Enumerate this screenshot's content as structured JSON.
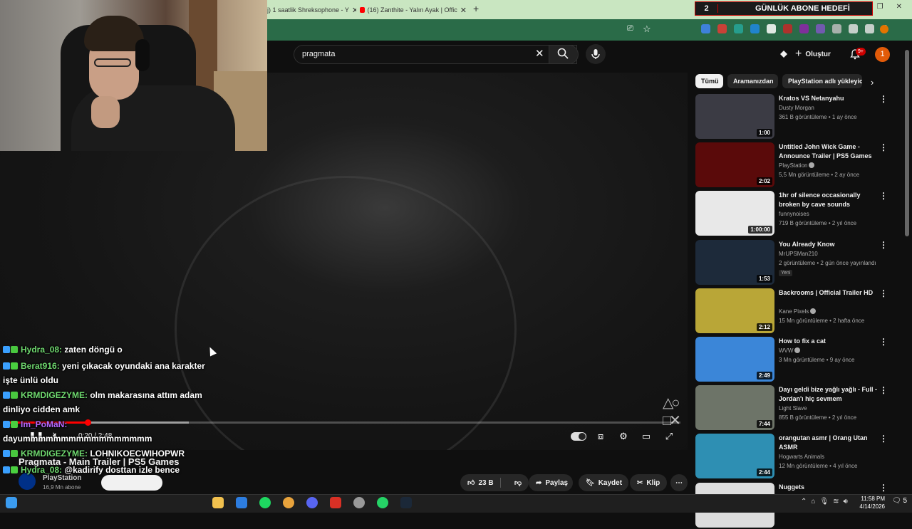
{
  "browser": {
    "tabs": [
      {
        "label": "j) 1 saatlik Shreksophone - Y"
      },
      {
        "label": "(16) Zanthite - Yalın Ayak | Offic"
      }
    ],
    "new_tab": "+",
    "close": "✕"
  },
  "stream_goal": {
    "count": "2",
    "label": "GÜNLÜK ABONE HEDEFİ"
  },
  "search": {
    "query": "pragmata"
  },
  "header": {
    "create_label": "Oluştur",
    "notif_badge": "9+",
    "avatar_letter": "1"
  },
  "player": {
    "time": "0:20 / 2:48",
    "progress_fraction": 0.12,
    "buffer_fraction": 0.27
  },
  "video": {
    "title": "Pragmata - Main Trailer | PS5 Games",
    "channel": "PlayStation",
    "subs": "16,9 Mn abone",
    "subscribe_label": "",
    "likes": "23 B",
    "share": "Paylaş",
    "save": "Kaydet",
    "clip": "Klip"
  },
  "chips": [
    {
      "label": "Tümü",
      "active": true
    },
    {
      "label": "Aramanızdan",
      "active": false
    },
    {
      "label": "PlayStation adlı yükleyici",
      "active": false
    }
  ],
  "recommendations": [
    {
      "title": "Kratos VS Netanyahu",
      "channel": "Dusty Morgan",
      "meta": "361 B görüntüleme • 1 ay önce",
      "duration": "1:00",
      "thumb": "#3b3b44",
      "verified": false
    },
    {
      "title": "Untitled John Wick Game - Announce Trailer | PS5 Games",
      "channel": "PlayStation",
      "meta": "5,5 Mn görüntüleme • 2 ay önce",
      "duration": "2:02",
      "thumb": "#5a0a0a",
      "verified": true
    },
    {
      "title": "1hr of silence occasionally broken by cave sounds",
      "channel": "funnynoises",
      "meta": "719 B görüntüleme • 2 yıl önce",
      "duration": "1:00:00",
      "thumb": "#e8e8e8",
      "verified": false
    },
    {
      "title": "You Already Know",
      "channel": "MrUPSMan210",
      "meta": "2 görüntüleme • 2 gün önce yayınlandı",
      "badge": "Yeni",
      "duration": "1:53",
      "thumb": "#1d2a3a",
      "verified": false
    },
    {
      "title": "Backrooms | Official Trailer HD",
      "channel": "Kane Pixels",
      "meta": "15 Mn görüntüleme • 2 hafta önce",
      "duration": "2:12",
      "thumb": "#b9a637",
      "verified": true
    },
    {
      "title": "How to fix a cat",
      "channel": "WVW",
      "meta": "3 Mn görüntüleme • 9 ay önce",
      "duration": "2:49",
      "thumb": "#3b86d8",
      "verified": true
    },
    {
      "title": "Dayı geldi bize yağlı yağlı - Full - Jordan'ı hiç sevmem",
      "channel": "Light Slave",
      "meta": "855 B görüntüleme • 2 yıl önce",
      "duration": "7:44",
      "thumb": "#6d7468",
      "verified": false
    },
    {
      "title": "orangutan asmr | Orang Utan ASMR",
      "channel": "Hogwarts Animals",
      "meta": "12 Mn görüntüleme • 4 yıl önce",
      "duration": "2:44",
      "thumb": "#2e8fb3",
      "verified": false
    },
    {
      "title": "Nuggets",
      "channel": "",
      "meta": "",
      "duration": "",
      "thumb": "#dddddd",
      "verified": false
    }
  ],
  "chat": [
    {
      "user": "Hydra_08:",
      "text": " zaten döngü o",
      "color": "#6fd96f"
    },
    {
      "user": "Berat916:",
      "text": " yeni çıkacak oyundaki ana karakter işte ünlü oldu",
      "color": "#6fd96f"
    },
    {
      "user": "KRMDIGEZYME:",
      "text": " olm makarasına attım adam dinliyo cidden amk",
      "color": "#6fd96f"
    },
    {
      "user": "Im_PoMaN:",
      "text": " dayummmmmmmmmmmmmmmmm",
      "color": "#b769ff"
    },
    {
      "user": "KRMDIGEZYME:",
      "text": " LOHNIKOECWIHOPWR",
      "color": "#6fd96f"
    },
    {
      "user": "Hydra_08:",
      "text": " @kadirify dosttan izle bence",
      "color": "#6fd96f"
    }
  ],
  "taskbar": {
    "time": "11:58 PM",
    "date": "4/14/2026",
    "notif_count": "5"
  }
}
